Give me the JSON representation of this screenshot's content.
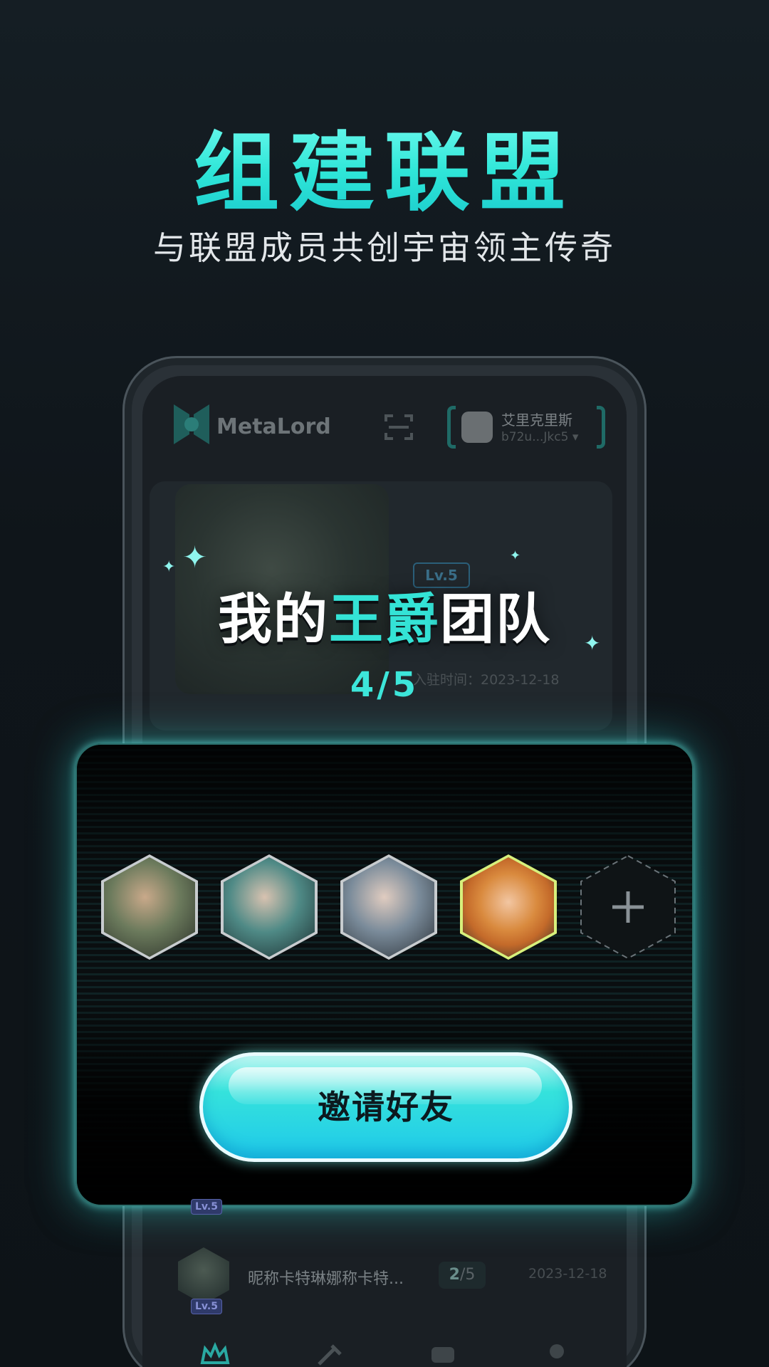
{
  "hero": {
    "title": "组建联盟",
    "subtitle": "与联盟成员共创宇宙领主传奇"
  },
  "app": {
    "logo_text": "MetaLord",
    "user_name": "艾里克里斯",
    "user_address": "b72u...Jkc5 ▾"
  },
  "card": {
    "level_tag": "Lv.5",
    "join_date": "入驻时间：2023-12-18"
  },
  "popup": {
    "title_part1": "我的",
    "title_highlight": "王爵",
    "title_part2": "团队",
    "count": "4/5"
  },
  "team": {
    "members": [
      {
        "name": "member-1",
        "tone": "#6b7a5c"
      },
      {
        "name": "member-2",
        "tone": "#4f8a86"
      },
      {
        "name": "member-3",
        "tone": "#7a8b9a"
      },
      {
        "name": "member-4",
        "tone": "#c98a4e"
      }
    ],
    "add_label": "+"
  },
  "invite_button": "邀请好友",
  "list": {
    "rows": [
      {
        "level": "Lv.5"
      },
      {
        "level": "Lv.5",
        "name": "昵称卡特琳娜称卡特...",
        "progress_current": "2",
        "progress_total": "/5",
        "date": "2023-12-18"
      }
    ]
  },
  "colors": {
    "accent": "#34e3d6",
    "background": "#10161b"
  }
}
